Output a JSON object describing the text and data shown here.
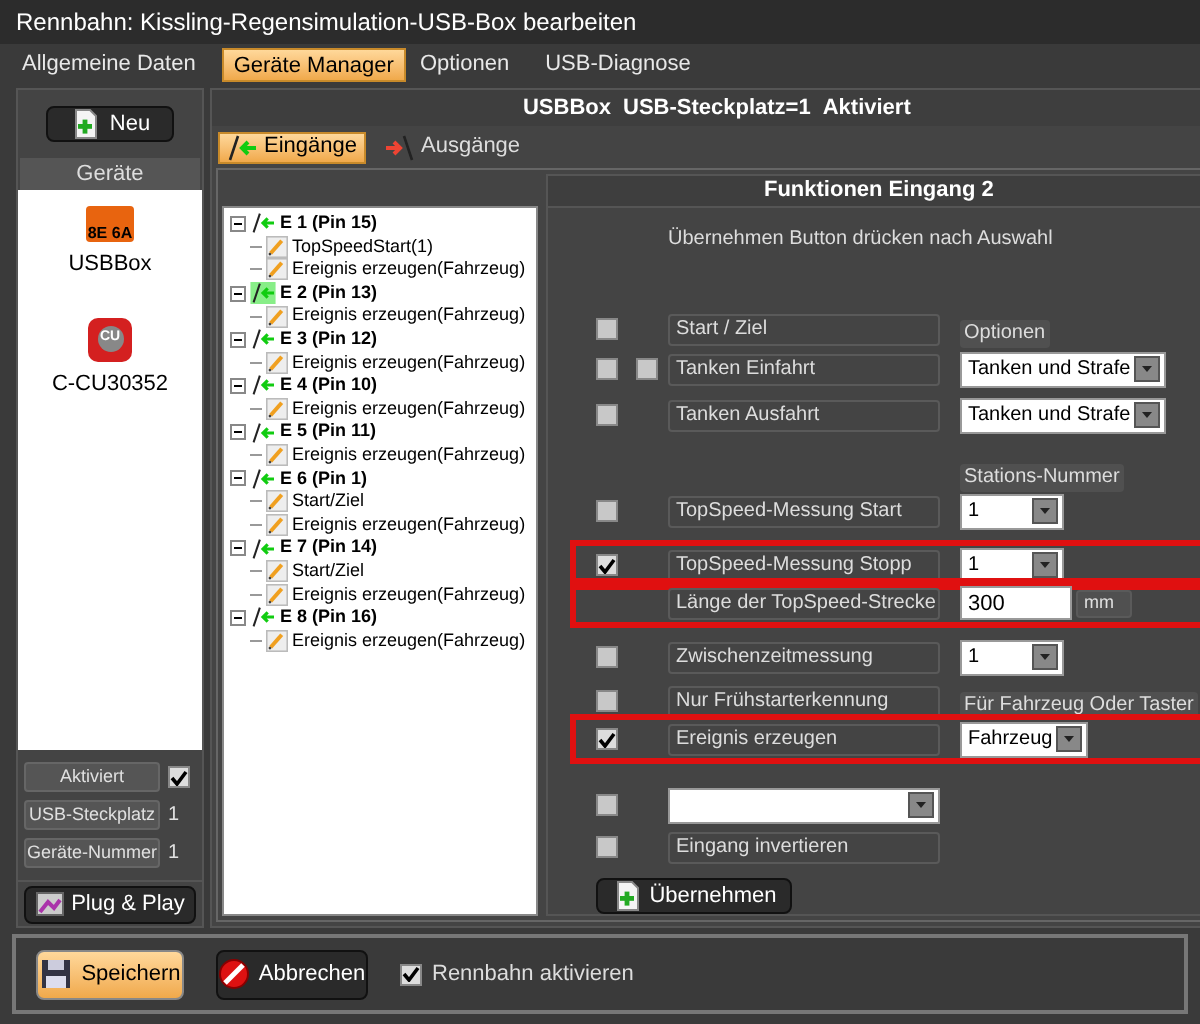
{
  "window": {
    "title": "Rennbahn: Kissling-Regensimulation-USB-Box bearbeiten"
  },
  "menu_tabs": [
    {
      "label": "Allgemeine Daten",
      "selected": false
    },
    {
      "label": "Geräte Manager",
      "selected": true
    },
    {
      "label": "Optionen",
      "selected": false
    },
    {
      "label": "USB-Diagnose",
      "selected": false
    }
  ],
  "sidebar": {
    "new_button": "Neu",
    "devices_header": "Geräte",
    "devices": [
      {
        "kind": "usb",
        "icon_text": "8E 6A",
        "label": "USBBox"
      },
      {
        "kind": "cu",
        "icon_text": "CU",
        "label": "C-CU30352"
      }
    ],
    "props": [
      {
        "label": "Aktiviert",
        "kind": "check",
        "checked": true
      },
      {
        "label": "USB-Steckplatz",
        "kind": "value",
        "value": "1"
      },
      {
        "label": "Geräte-Nummer",
        "kind": "value",
        "value": "1"
      }
    ],
    "plug_button": "Plug & Play"
  },
  "device_header": {
    "name": "USBBox",
    "slot": "USB-Steckplatz=1",
    "state": "Aktiviert"
  },
  "io_tabs": [
    {
      "kind": "in",
      "label": "Eingänge",
      "selected": true
    },
    {
      "kind": "out",
      "label": "Ausgänge",
      "selected": false
    }
  ],
  "tree": [
    {
      "label": "E 1 (Pin 15)",
      "selected": false,
      "children": [
        {
          "label": "TopSpeedStart(1)"
        },
        {
          "label": "Ereignis erzeugen(Fahrzeug)"
        }
      ]
    },
    {
      "label": "E 2 (Pin 13)",
      "selected": true,
      "children": [
        {
          "label": "Ereignis erzeugen(Fahrzeug)"
        }
      ]
    },
    {
      "label": "E 3 (Pin 12)",
      "selected": false,
      "children": [
        {
          "label": "Ereignis erzeugen(Fahrzeug)"
        }
      ]
    },
    {
      "label": "E 4 (Pin 10)",
      "selected": false,
      "children": [
        {
          "label": "Ereignis erzeugen(Fahrzeug)"
        }
      ]
    },
    {
      "label": "E 5 (Pin 11)",
      "selected": false,
      "children": [
        {
          "label": "Ereignis erzeugen(Fahrzeug)"
        }
      ]
    },
    {
      "label": "E 6 (Pin 1)",
      "selected": false,
      "children": [
        {
          "label": "Start/Ziel"
        },
        {
          "label": "Ereignis erzeugen(Fahrzeug)"
        }
      ]
    },
    {
      "label": "E 7 (Pin 14)",
      "selected": false,
      "children": [
        {
          "label": "Start/Ziel"
        },
        {
          "label": "Ereignis erzeugen(Fahrzeug)"
        }
      ]
    },
    {
      "label": "E 8 (Pin 16)",
      "selected": false,
      "children": [
        {
          "label": "Ereignis erzeugen(Fahrzeug)"
        }
      ]
    }
  ],
  "functions": {
    "title": "Funktionen Eingang 2",
    "hint": "Übernehmen Button drücken nach Auswahl",
    "rows": [
      {
        "kind": "option",
        "checked": false,
        "label": "Start / Ziel",
        "caption": "Optionen",
        "highlighted": false
      },
      {
        "kind": "option",
        "checked": false,
        "checked2": false,
        "label": "Tanken Einfahrt",
        "select": "Tanken und Strafe",
        "highlighted": false
      },
      {
        "kind": "option",
        "checked": false,
        "label": "Tanken Ausfahrt",
        "select": "Tanken und Strafe",
        "highlighted": false
      },
      {
        "kind": "caption",
        "caption": "Stations-Nummer"
      },
      {
        "kind": "option",
        "checked": false,
        "label": "TopSpeed-Messung Start",
        "select": "1",
        "highlighted": false
      },
      {
        "kind": "option",
        "checked": true,
        "label": "TopSpeed-Messung Stopp",
        "select": "1",
        "highlighted": true
      },
      {
        "kind": "length",
        "label": "Länge der TopSpeed-Strecke",
        "value": "300",
        "unit": "mm",
        "highlighted": true
      },
      {
        "kind": "option",
        "checked": false,
        "label": "Zwischenzeitmessung",
        "select": "1",
        "highlighted": false
      },
      {
        "kind": "option",
        "checked": false,
        "label": "Nur Frühstarterkennung",
        "caption": "Für Fahrzeug Oder Taster",
        "highlighted": false
      },
      {
        "kind": "option",
        "checked": true,
        "label": "Ereignis erzeugen",
        "select": "Fahrzeug",
        "highlighted": true
      },
      {
        "kind": "combo",
        "checked": false
      },
      {
        "kind": "option",
        "checked": false,
        "label": "Eingang invertieren",
        "highlighted": false
      }
    ],
    "apply_button": "Übernehmen"
  },
  "footer": {
    "save_button": "Speichern",
    "cancel_button": "Abbrechen",
    "track_active": {
      "label": "Rennbahn aktivieren",
      "checked": true
    }
  }
}
